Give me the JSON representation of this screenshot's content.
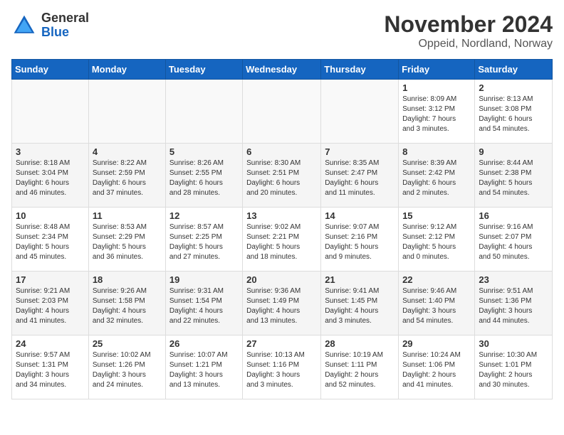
{
  "logo": {
    "general": "General",
    "blue": "Blue"
  },
  "title": "November 2024",
  "subtitle": "Oppeid, Nordland, Norway",
  "days_of_week": [
    "Sunday",
    "Monday",
    "Tuesday",
    "Wednesday",
    "Thursday",
    "Friday",
    "Saturday"
  ],
  "weeks": [
    [
      {
        "day": "",
        "info": ""
      },
      {
        "day": "",
        "info": ""
      },
      {
        "day": "",
        "info": ""
      },
      {
        "day": "",
        "info": ""
      },
      {
        "day": "",
        "info": ""
      },
      {
        "day": "1",
        "info": "Sunrise: 8:09 AM\nSunset: 3:12 PM\nDaylight: 7 hours\nand 3 minutes."
      },
      {
        "day": "2",
        "info": "Sunrise: 8:13 AM\nSunset: 3:08 PM\nDaylight: 6 hours\nand 54 minutes."
      }
    ],
    [
      {
        "day": "3",
        "info": "Sunrise: 8:18 AM\nSunset: 3:04 PM\nDaylight: 6 hours\nand 46 minutes."
      },
      {
        "day": "4",
        "info": "Sunrise: 8:22 AM\nSunset: 2:59 PM\nDaylight: 6 hours\nand 37 minutes."
      },
      {
        "day": "5",
        "info": "Sunrise: 8:26 AM\nSunset: 2:55 PM\nDaylight: 6 hours\nand 28 minutes."
      },
      {
        "day": "6",
        "info": "Sunrise: 8:30 AM\nSunset: 2:51 PM\nDaylight: 6 hours\nand 20 minutes."
      },
      {
        "day": "7",
        "info": "Sunrise: 8:35 AM\nSunset: 2:47 PM\nDaylight: 6 hours\nand 11 minutes."
      },
      {
        "day": "8",
        "info": "Sunrise: 8:39 AM\nSunset: 2:42 PM\nDaylight: 6 hours\nand 2 minutes."
      },
      {
        "day": "9",
        "info": "Sunrise: 8:44 AM\nSunset: 2:38 PM\nDaylight: 5 hours\nand 54 minutes."
      }
    ],
    [
      {
        "day": "10",
        "info": "Sunrise: 8:48 AM\nSunset: 2:34 PM\nDaylight: 5 hours\nand 45 minutes."
      },
      {
        "day": "11",
        "info": "Sunrise: 8:53 AM\nSunset: 2:29 PM\nDaylight: 5 hours\nand 36 minutes."
      },
      {
        "day": "12",
        "info": "Sunrise: 8:57 AM\nSunset: 2:25 PM\nDaylight: 5 hours\nand 27 minutes."
      },
      {
        "day": "13",
        "info": "Sunrise: 9:02 AM\nSunset: 2:21 PM\nDaylight: 5 hours\nand 18 minutes."
      },
      {
        "day": "14",
        "info": "Sunrise: 9:07 AM\nSunset: 2:16 PM\nDaylight: 5 hours\nand 9 minutes."
      },
      {
        "day": "15",
        "info": "Sunrise: 9:12 AM\nSunset: 2:12 PM\nDaylight: 5 hours\nand 0 minutes."
      },
      {
        "day": "16",
        "info": "Sunrise: 9:16 AM\nSunset: 2:07 PM\nDaylight: 4 hours\nand 50 minutes."
      }
    ],
    [
      {
        "day": "17",
        "info": "Sunrise: 9:21 AM\nSunset: 2:03 PM\nDaylight: 4 hours\nand 41 minutes."
      },
      {
        "day": "18",
        "info": "Sunrise: 9:26 AM\nSunset: 1:58 PM\nDaylight: 4 hours\nand 32 minutes."
      },
      {
        "day": "19",
        "info": "Sunrise: 9:31 AM\nSunset: 1:54 PM\nDaylight: 4 hours\nand 22 minutes."
      },
      {
        "day": "20",
        "info": "Sunrise: 9:36 AM\nSunset: 1:49 PM\nDaylight: 4 hours\nand 13 minutes."
      },
      {
        "day": "21",
        "info": "Sunrise: 9:41 AM\nSunset: 1:45 PM\nDaylight: 4 hours\nand 3 minutes."
      },
      {
        "day": "22",
        "info": "Sunrise: 9:46 AM\nSunset: 1:40 PM\nDaylight: 3 hours\nand 54 minutes."
      },
      {
        "day": "23",
        "info": "Sunrise: 9:51 AM\nSunset: 1:36 PM\nDaylight: 3 hours\nand 44 minutes."
      }
    ],
    [
      {
        "day": "24",
        "info": "Sunrise: 9:57 AM\nSunset: 1:31 PM\nDaylight: 3 hours\nand 34 minutes."
      },
      {
        "day": "25",
        "info": "Sunrise: 10:02 AM\nSunset: 1:26 PM\nDaylight: 3 hours\nand 24 minutes."
      },
      {
        "day": "26",
        "info": "Sunrise: 10:07 AM\nSunset: 1:21 PM\nDaylight: 3 hours\nand 13 minutes."
      },
      {
        "day": "27",
        "info": "Sunrise: 10:13 AM\nSunset: 1:16 PM\nDaylight: 3 hours\nand 3 minutes."
      },
      {
        "day": "28",
        "info": "Sunrise: 10:19 AM\nSunset: 1:11 PM\nDaylight: 2 hours\nand 52 minutes."
      },
      {
        "day": "29",
        "info": "Sunrise: 10:24 AM\nSunset: 1:06 PM\nDaylight: 2 hours\nand 41 minutes."
      },
      {
        "day": "30",
        "info": "Sunrise: 10:30 AM\nSunset: 1:01 PM\nDaylight: 2 hours\nand 30 minutes."
      }
    ]
  ]
}
